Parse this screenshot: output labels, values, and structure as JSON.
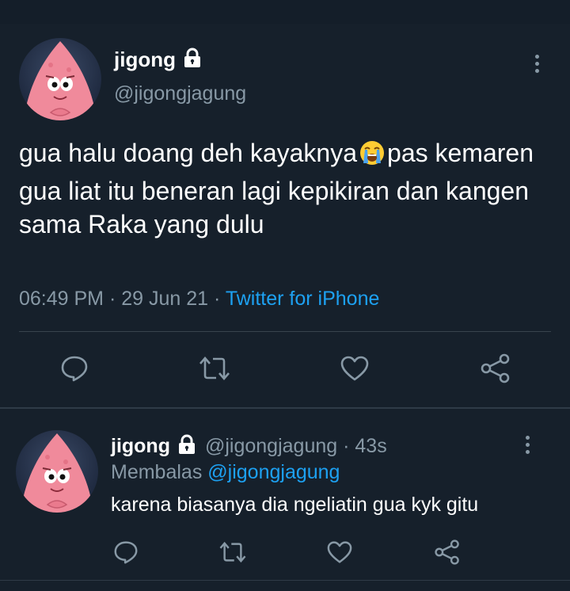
{
  "main_tweet": {
    "author_name": "jigong",
    "author_handle": "@jigongjagung",
    "text_part1": "gua halu doang deh kayaknya",
    "text_part2": "pas kemaren gua liat itu beneran lagi kepikiran dan kangen sama Raka yang dulu",
    "emoji_icon": "loudly-crying-face-icon",
    "time": "06:49 PM",
    "date": "29 Jun 21",
    "separator": "·",
    "source": "Twitter for iPhone"
  },
  "reply_tweet": {
    "author_name": "jigong",
    "author_handle": "@jigongjagung",
    "separator": "·",
    "time_ago": "43s",
    "replying_label": "Membalas",
    "replying_to": "@jigongjagung",
    "text": "karena biasanya dia ngeliatin gua kyk gitu"
  },
  "icons": [
    "reply-icon",
    "retweet-icon",
    "like-icon",
    "share-icon",
    "lock-icon",
    "more-icon"
  ],
  "colors": {
    "background": "#16202b",
    "link": "#1da1f2",
    "secondary_text": "#8899a6",
    "divider": "#38444d"
  }
}
